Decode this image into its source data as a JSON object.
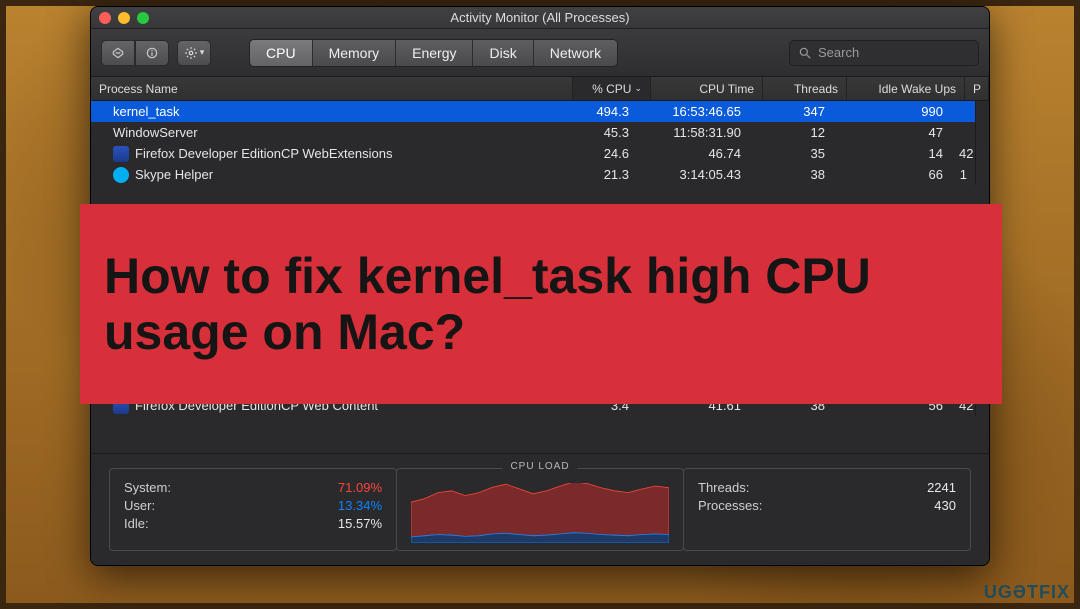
{
  "window": {
    "title": "Activity Monitor (All Processes)"
  },
  "toolbar": {
    "tabs": [
      "CPU",
      "Memory",
      "Energy",
      "Disk",
      "Network"
    ],
    "active_tab": 0,
    "search_placeholder": "Search"
  },
  "columns": {
    "name": "Process Name",
    "cpu": "% CPU",
    "time": "CPU Time",
    "threads": "Threads",
    "wakeups": "Idle Wake Ups",
    "last": "P"
  },
  "rows": [
    {
      "name": "kernel_task",
      "icon": "",
      "cpu": "494.3",
      "time": "16:53:46.65",
      "threads": "347",
      "wakeups": "990",
      "last": "",
      "selected": true
    },
    {
      "name": "WindowServer",
      "icon": "",
      "cpu": "45.3",
      "time": "11:58:31.90",
      "threads": "12",
      "wakeups": "47",
      "last": "",
      "selected": false
    },
    {
      "name": "Firefox Developer EditionCP WebExtensions",
      "icon": "ff",
      "cpu": "24.6",
      "time": "46.74",
      "threads": "35",
      "wakeups": "14",
      "last": "42",
      "selected": false
    },
    {
      "name": "Skype Helper",
      "icon": "sk",
      "cpu": "21.3",
      "time": "3:14:05.43",
      "threads": "38",
      "wakeups": "66",
      "last": "1",
      "selected": false
    }
  ],
  "after_row": {
    "name": "Firefox Developer EditionCP Web Content",
    "icon": "ff",
    "cpu": "3.4",
    "time": "41.61",
    "threads": "38",
    "wakeups": "56",
    "last": "42"
  },
  "footer": {
    "left": [
      {
        "label": "System:",
        "value": "71.09%",
        "cls": "red"
      },
      {
        "label": "User:",
        "value": "13.34%",
        "cls": "blue"
      },
      {
        "label": "Idle:",
        "value": "15.57%",
        "cls": ""
      }
    ],
    "chart_title": "CPU LOAD",
    "right": [
      {
        "label": "Threads:",
        "value": "2241"
      },
      {
        "label": "Processes:",
        "value": "430"
      }
    ]
  },
  "banner": {
    "text": "How to fix kernel_task high CPU usage on Mac?"
  },
  "watermark": "UGƏTFIX",
  "chart_data": {
    "type": "area",
    "title": "CPU LOAD",
    "xlabel": "",
    "ylabel": "",
    "ylim": [
      0,
      100
    ],
    "x": [
      0,
      1,
      2,
      3,
      4,
      5,
      6,
      7,
      8,
      9,
      10,
      11,
      12,
      13,
      14,
      15,
      16,
      17,
      18,
      19
    ],
    "series": [
      {
        "name": "System",
        "color": "#ff453a",
        "values": [
          58,
          62,
          70,
          74,
          68,
          72,
          78,
          82,
          76,
          70,
          74,
          80,
          85,
          83,
          78,
          74,
          72,
          76,
          80,
          78
        ]
      },
      {
        "name": "User",
        "color": "#0a84ff",
        "values": [
          10,
          12,
          14,
          13,
          11,
          12,
          15,
          16,
          14,
          12,
          13,
          15,
          17,
          16,
          14,
          13,
          12,
          14,
          15,
          14
        ]
      }
    ]
  }
}
